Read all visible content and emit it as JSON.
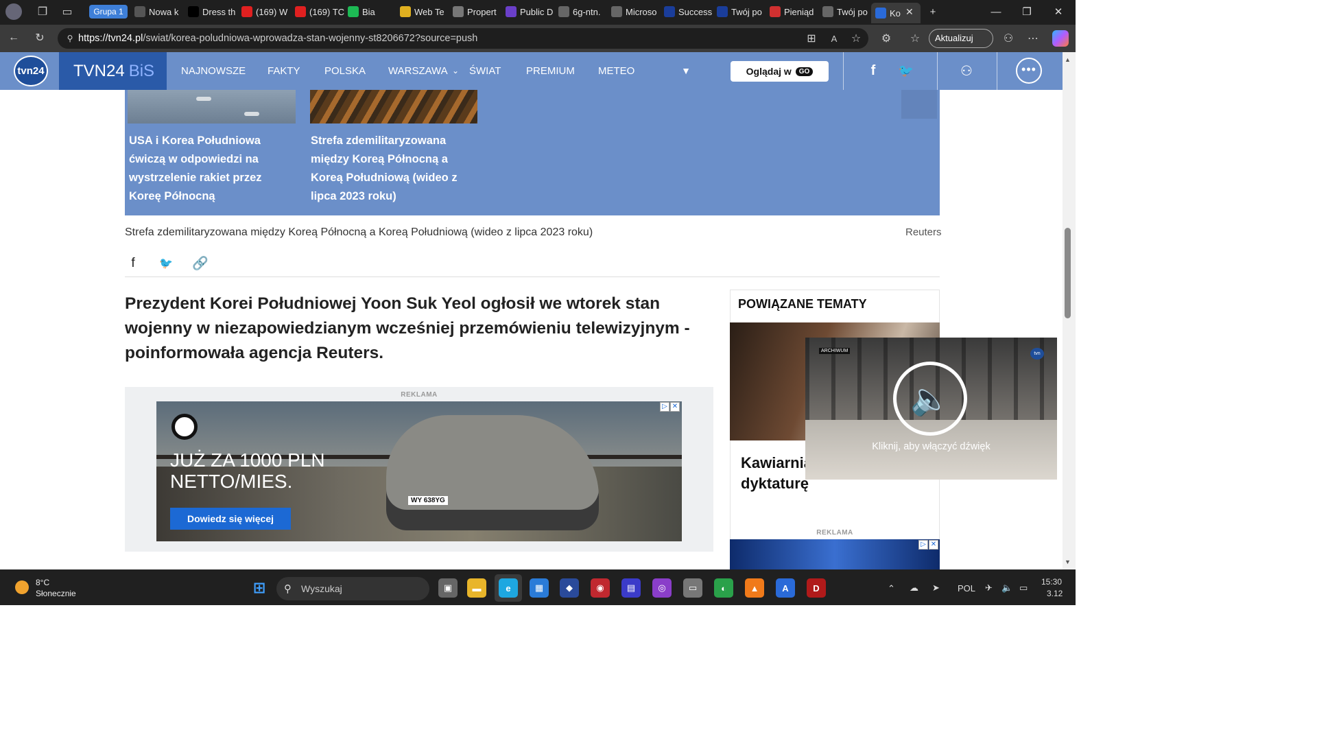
{
  "browser": {
    "group_label": "Grupa 1",
    "tabs": [
      {
        "title": "Nowa k",
        "icon": "tab-page-icon",
        "color": "#555555"
      },
      {
        "title": "Dress th",
        "icon": "medium-icon",
        "color": "#000000"
      },
      {
        "title": "(169) W",
        "icon": "youtube-icon",
        "color": "#e02020"
      },
      {
        "title": "(169) TC",
        "icon": "youtube-icon",
        "color": "#e02020"
      },
      {
        "title": "Bia",
        "icon": "spotify-icon",
        "color": "#1db954"
      },
      {
        "title": "Web Te",
        "icon": "web-icon",
        "color": "#e0b020"
      },
      {
        "title": "Propert",
        "icon": "property-icon",
        "color": "#777777"
      },
      {
        "title": "Public D",
        "icon": "public-icon",
        "color": "#6a3fc9"
      },
      {
        "title": "6g-ntn.",
        "icon": "globe-icon",
        "color": "#666666"
      },
      {
        "title": "Microso",
        "icon": "globe-icon",
        "color": "#666666"
      },
      {
        "title": "Success",
        "icon": "eu-icon",
        "color": "#1a3d9a"
      },
      {
        "title": "Twój po",
        "icon": "eu-icon",
        "color": "#1a3d9a"
      },
      {
        "title": "Pieniąd",
        "icon": "pdf-icon",
        "color": "#d03030"
      },
      {
        "title": "Twój po",
        "icon": "globe-icon",
        "color": "#666666"
      },
      {
        "title": "Ko",
        "icon": "tvn-icon",
        "color": "#2a6ad8"
      }
    ],
    "url_host": "https://tvn24.pl",
    "url_path": "/swiat/korea-poludniowa-wprowadza-stan-wojenny-st8206672?source=push",
    "update_label": "Aktualizuj"
  },
  "site": {
    "logo_text": "tvn24",
    "brand": "TVN24",
    "brand_suffix": "BiS",
    "nav": [
      "NAJNOWSZE",
      "FAKTY",
      "POLSKA",
      "WARSZAWA",
      "ŚWIAT",
      "PREMIUM",
      "METEO"
    ],
    "watch_label": "Oglądaj w",
    "watch_badge": "GO",
    "header_color": "#6b8fc9"
  },
  "article": {
    "cards": [
      {
        "title": "USA i Korea Południowa ćwiczą w odpowiedzi na wystrzelenie rakiet przez Koreę Północną"
      },
      {
        "title": "Strefa zdemilitaryzowana między Koreą Północną a Koreą Południową (wideo z lipca 2023 roku)"
      }
    ],
    "caption": "Strefa zdemilitaryzowana między Koreą Północną a Koreą Południową (wideo z lipca 2023 roku)",
    "source": "Reuters",
    "lead": "Prezydent Korei Południowej Yoon Suk Yeol ogłosił we wtorek stan wojenny w niezapowiedzianym wcześniej przemówieniu telewizyjnym - poinformowała agencja Reuters.",
    "ad": {
      "label": "REKLAMA",
      "headline_1": "JUŻ ZA 1000 PLN",
      "headline_2": "NETTO/MIES.",
      "cta": "Dowiedz się więcej",
      "plate": "WY 638YG"
    }
  },
  "sidebar": {
    "heading": "POWIĄZANE TEMATY",
    "story_title_1": "Kawiarnia",
    "story_title_2": "dyktaturę",
    "ad_label": "REKLAMA"
  },
  "video": {
    "badge": "ARCHIWUM",
    "corner_logo": "tvn",
    "unmute_text": "Kliknij, aby włączyć dźwięk"
  },
  "taskbar": {
    "temperature": "8°C",
    "weather": "Słonecznie",
    "search_placeholder": "Wyszukaj",
    "language": "POL",
    "time": "15:30",
    "date": "3.12"
  }
}
